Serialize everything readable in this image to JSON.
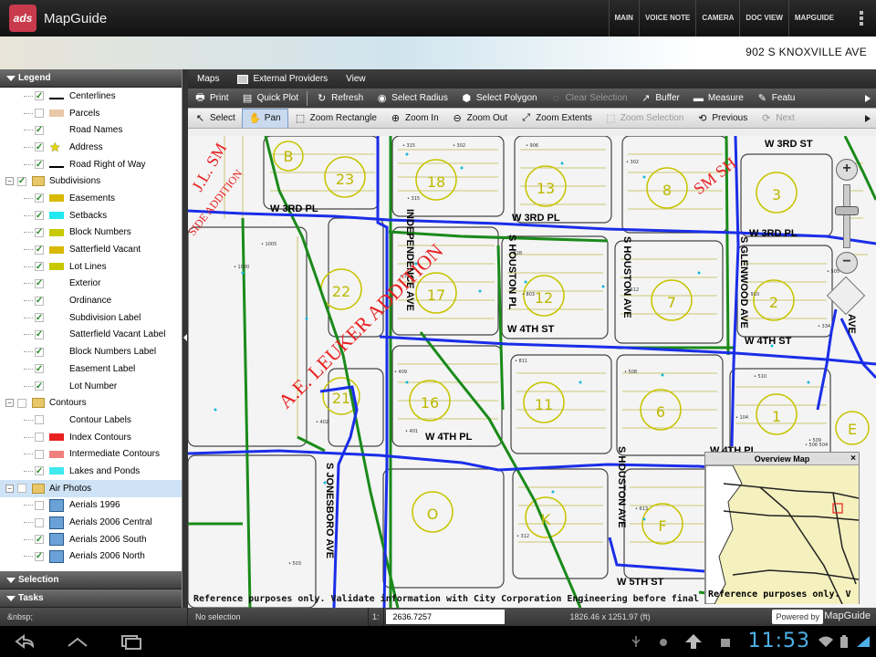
{
  "app": {
    "logo_text": "ads",
    "title": "MapGuide"
  },
  "topnav": [
    "MAIN",
    "VOICE NOTE",
    "CAMERA",
    "DOC VIEW",
    "MAPGUIDE"
  ],
  "banner": {
    "address": "902 S KNOXVILLE AVE"
  },
  "legend": {
    "header": "Legend",
    "items": [
      {
        "label": "Centerlines",
        "checked": true,
        "swatch": "line",
        "indent": 2
      },
      {
        "label": "Parcels",
        "checked": false,
        "swatch": "#e8c8a8",
        "indent": 2
      },
      {
        "label": "Road Names",
        "checked": true,
        "swatch": "none",
        "indent": 2
      },
      {
        "label": "Address",
        "checked": true,
        "swatch": "star",
        "indent": 2
      },
      {
        "label": "Road Right of Way",
        "checked": true,
        "swatch": "line",
        "indent": 2
      },
      {
        "label": "Subdivisions",
        "checked": true,
        "swatch": "folder",
        "indent": 1,
        "group": true
      },
      {
        "label": "Easements",
        "checked": true,
        "swatch": "#d8b800",
        "indent": 2
      },
      {
        "label": "Setbacks",
        "checked": true,
        "swatch": "#22e8f0",
        "indent": 2
      },
      {
        "label": "Block Numbers",
        "checked": true,
        "swatch": "#c8c800",
        "indent": 2
      },
      {
        "label": "Satterfield Vacant",
        "checked": true,
        "swatch": "#d8b800",
        "indent": 2
      },
      {
        "label": "Lot Lines",
        "checked": true,
        "swatch": "#c8c800",
        "indent": 2
      },
      {
        "label": "Exterior",
        "checked": true,
        "swatch": "none",
        "indent": 2
      },
      {
        "label": "Ordinance",
        "checked": true,
        "swatch": "none",
        "indent": 2
      },
      {
        "label": "Subdivision Label",
        "checked": true,
        "swatch": "none",
        "indent": 2
      },
      {
        "label": "Satterfield Vacant Label",
        "checked": true,
        "swatch": "none",
        "indent": 2
      },
      {
        "label": "Block Numbers Label",
        "checked": true,
        "swatch": "none",
        "indent": 2
      },
      {
        "label": "Easement Label",
        "checked": true,
        "swatch": "none",
        "indent": 2
      },
      {
        "label": "Lot Number",
        "checked": true,
        "swatch": "none",
        "indent": 2
      },
      {
        "label": "Contours",
        "checked": false,
        "swatch": "folder",
        "indent": 1,
        "group": true
      },
      {
        "label": "Contour Labels",
        "checked": false,
        "swatch": "none",
        "indent": 2
      },
      {
        "label": "Index Contours",
        "checked": false,
        "swatch": "#e82020",
        "indent": 2
      },
      {
        "label": "Intermediate Contours",
        "checked": false,
        "swatch": "#f08080",
        "indent": 2
      },
      {
        "label": "Lakes and Ponds",
        "checked": true,
        "swatch": "#40e8f0",
        "indent": 2
      },
      {
        "label": "Air Photos",
        "checked": false,
        "swatch": "folder",
        "indent": 1,
        "group": true,
        "selected": true
      },
      {
        "label": "Aerials 1996",
        "checked": false,
        "swatch": "img",
        "indent": 2
      },
      {
        "label": "Aerials 2006 Central",
        "checked": false,
        "swatch": "img",
        "indent": 2
      },
      {
        "label": "Aerials 2006 South",
        "checked": true,
        "swatch": "img",
        "indent": 2
      },
      {
        "label": "Aerials 2006 North",
        "checked": true,
        "swatch": "img",
        "indent": 2
      }
    ],
    "selection_header": "Selection",
    "tasks_header": "Tasks"
  },
  "menubar": [
    "Maps",
    "External Providers",
    "View"
  ],
  "toolbar1": [
    {
      "label": "Print",
      "icon": "printer-icon",
      "enabled": true
    },
    {
      "label": "Quick Plot",
      "icon": "quick-plot-icon",
      "enabled": true
    },
    {
      "label": "Refresh",
      "icon": "refresh-icon",
      "enabled": true
    },
    {
      "label": "Select Radius",
      "icon": "select-radius-icon",
      "enabled": true
    },
    {
      "label": "Select Polygon",
      "icon": "select-polygon-icon",
      "enabled": true
    },
    {
      "label": "Clear Selection",
      "icon": "clear-selection-icon",
      "enabled": false
    },
    {
      "label": "Buffer",
      "icon": "buffer-icon",
      "enabled": true
    },
    {
      "label": "Measure",
      "icon": "measure-icon",
      "enabled": true
    },
    {
      "label": "Featu",
      "icon": "feature-info-icon",
      "enabled": true
    }
  ],
  "toolbar2": [
    {
      "label": "Select",
      "icon": "select-arrow-icon",
      "enabled": true
    },
    {
      "label": "Pan",
      "icon": "pan-hand-icon",
      "enabled": true,
      "active": true
    },
    {
      "label": "Zoom Rectangle",
      "icon": "zoom-rectangle-icon",
      "enabled": true
    },
    {
      "label": "Zoom In",
      "icon": "zoom-in-icon",
      "enabled": true
    },
    {
      "label": "Zoom Out",
      "icon": "zoom-out-icon",
      "enabled": true
    },
    {
      "label": "Zoom Extents",
      "icon": "zoom-extents-icon",
      "enabled": true
    },
    {
      "label": "Zoom Selection",
      "icon": "zoom-selection-icon",
      "enabled": false
    },
    {
      "label": "Previous",
      "icon": "previous-view-icon",
      "enabled": true
    },
    {
      "label": "Next",
      "icon": "next-view-icon",
      "enabled": false
    }
  ],
  "map": {
    "streets": {
      "w3rdst": "W 3RD ST",
      "w3rdpl_left": "W 3RD PL",
      "w3rdpl_mid": "W 3RD PL",
      "w3rdpl_right": "W 3RD PL",
      "w4thst_mid": "W 4TH ST",
      "w4thst_right": "W 4TH ST",
      "w4thpl_mid": "W 4TH PL",
      "w4thpl_right": "W 4TH PL",
      "w5thst": "W 5TH ST",
      "independence": "INDEPENDENCE AVE",
      "houston_pl": "S HOUSTON PL",
      "houston_ave1": "S HOUSTON AVE",
      "houston_ave2": "S HOUSTON AVE",
      "glenwood": "S GLENWOOD AVE",
      "jonesboro": "S JONESBORO AVE",
      "eighth": "AVE"
    },
    "subdivision_labels": {
      "leuker": "A.E. LEUKER ADDITION",
      "jl": "J.L. SM",
      "side_addition": "SIDE ADDITION",
      "sm": "SM SH"
    },
    "blocks": [
      "23",
      "18",
      "13",
      "8",
      "3",
      "22",
      "17",
      "12",
      "7",
      "2",
      "21",
      "16",
      "11",
      "6",
      "1",
      "O",
      "K",
      "F",
      "E",
      "B"
    ],
    "disclaimer": "Reference purposes only. Validate information with City Corporation Engineering before final"
  },
  "overview": {
    "title": "Overview Map",
    "disclaimer": "Reference purposes only. V"
  },
  "status": {
    "left": "&nbsp;",
    "selection": "No selection",
    "scale_prefix": "1:",
    "scale": "2636.7257",
    "extent": "1826.46 x 1251.97 (ft)",
    "powered_by": "Powered by",
    "brand": "MapGuide"
  },
  "system": {
    "clock": "11:53"
  }
}
